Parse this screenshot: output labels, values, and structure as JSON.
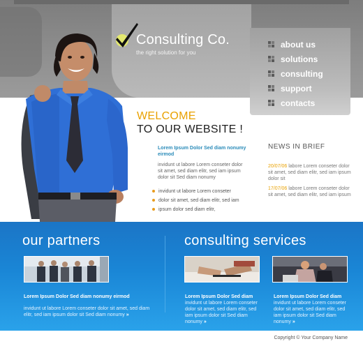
{
  "logo": {
    "name": "Consulting Co.",
    "tagline": "the right solution for you"
  },
  "nav": {
    "items": [
      {
        "label": "about us"
      },
      {
        "label": "solutions"
      },
      {
        "label": "consulting"
      },
      {
        "label": "support"
      },
      {
        "label": "contacts"
      }
    ]
  },
  "welcome": {
    "line1": "WELCOME",
    "line2": "TO OUR WEBSITE !",
    "heading": "Lorem Ipsum Dolor Sed diam nonumy eirmod",
    "text": "invidunt ut labore Lorem conseter dolor sit amet, sed diam elitr, sed iam ipsum dolor sit Sed diam nonumy",
    "bullets": [
      "invidunt ut labore Lorem conseter",
      "dolor sit amet, sed diam elitr, sed iam",
      "ipsum dolor sed diam elitr,"
    ]
  },
  "news": {
    "title": "NEWS IN BRIEF",
    "items": [
      {
        "date": "20/07/06",
        "text": "labore Lorem conseter dolor sit amet, sed diam elitr, sed iam ipsum dolor sit"
      },
      {
        "date": "17/07/06",
        "text": "labore Lorem conseter dolor sit amet, sed diam elitr, sed iam ipsum"
      }
    ]
  },
  "partners": {
    "title": "our partners",
    "heading": "Lorem Ipsum Dolor Sed diam nonumy eirmod",
    "text": "invidunt ut labore Lorem conseter dolor sit amet, sed diam elitr, sed iam ipsum dolor sit Sed diam nonumy",
    "more": "»"
  },
  "services": {
    "title": "consulting services",
    "cards": [
      {
        "heading": "Lorem Ipsum Dolor Sed diam",
        "text": "invidunt ut labore Lorem conseter dolor sit amet, sed diam elitr, sed iam ipsum dolor sit Sed diam nonumy",
        "more": "»"
      },
      {
        "heading": "Lorem Ipsum Dolor Sed diam",
        "text": "invidunt ut labore Lorem conseter dolor sit amet, sed diam elitr, sed iam ipsum dolor sit Sed diam nonumy",
        "more": "»"
      }
    ]
  },
  "footer": {
    "copyright": "Copyright © Your Company Name"
  },
  "colors": {
    "accent_orange": "#e9a100",
    "link_blue": "#2a8bb9",
    "band_blue": "#1a86d6",
    "header_grey": "#8d8d8d"
  }
}
